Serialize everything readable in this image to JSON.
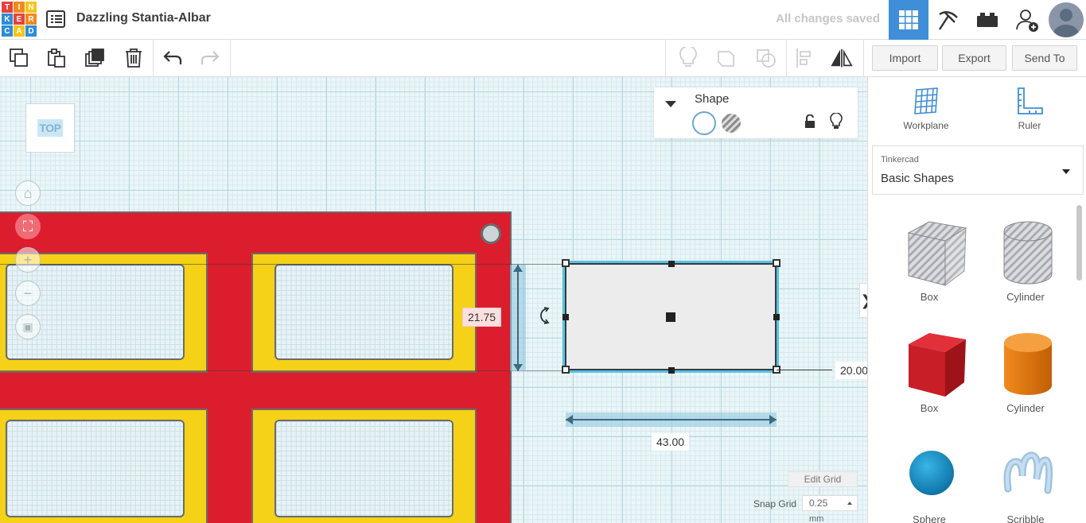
{
  "app": {
    "logo_letters": [
      "T",
      "I",
      "N",
      "K",
      "E",
      "R",
      "C",
      "A",
      "D"
    ],
    "logo_colors": [
      "#e8413c",
      "#f08a1d",
      "#f5c518",
      "#2d8dd6",
      "#e8413c",
      "#f08a1d",
      "#2d8dd6",
      "#f5c518",
      "#2d8dd6"
    ],
    "document_title": "Dazzling Stantia-Albar",
    "save_status": "All changes saved"
  },
  "topbar_icons": [
    "grid-view-icon",
    "pickaxe-icon",
    "bricks-icon",
    "add-user-icon",
    "avatar"
  ],
  "toolbar": {
    "import_label": "Import",
    "export_label": "Export",
    "send_to_label": "Send To"
  },
  "workplane": {
    "view_cube_label": "TOP",
    "height_dimension": "21.75",
    "width_dimension": "43.00",
    "side_dimension": "20.00",
    "edit_grid_label": "Edit Grid",
    "snap_grid_label": "Snap Grid",
    "snap_grid_value": "0.25",
    "snap_grid_unit": "mm",
    "accent_color": "#56c2e6"
  },
  "shape_panel": {
    "title": "Shape"
  },
  "right_panel": {
    "workplane_label": "Workplane",
    "ruler_label": "Ruler",
    "library_vendor": "Tinkercad",
    "library_name": "Basic Shapes",
    "shapes": [
      {
        "label": "Box",
        "kind": "box-hole"
      },
      {
        "label": "Cylinder",
        "kind": "cylinder-hole"
      },
      {
        "label": "Box",
        "kind": "box-solid"
      },
      {
        "label": "Cylinder",
        "kind": "cylinder-solid"
      },
      {
        "label": "Sphere",
        "kind": "sphere"
      },
      {
        "label": "Scribble",
        "kind": "scribble"
      }
    ]
  }
}
